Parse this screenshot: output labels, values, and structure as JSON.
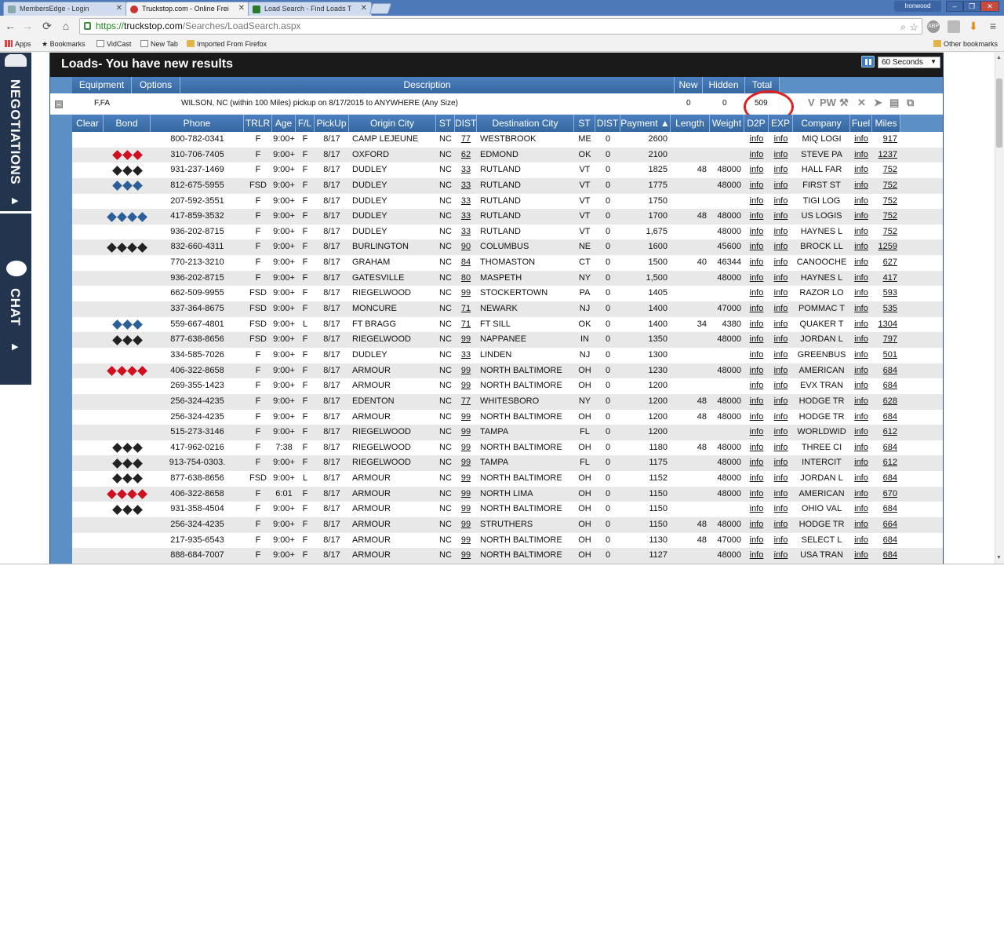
{
  "browser": {
    "tabs": [
      {
        "title": "MembersEdge - Login"
      },
      {
        "title": "Truckstop.com - Online Frei"
      },
      {
        "title": "Load Search - Find Loads T"
      }
    ],
    "profile_name": "Ironwood",
    "url": {
      "scheme": "https://",
      "host": "truckstop.com",
      "path": "/Searches/LoadSearch.aspx"
    },
    "ext_icon_label": "ABP",
    "bookmarks": [
      "Apps",
      "Bookmarks",
      "VidCast",
      "New Tab",
      "Imported From Firefox"
    ],
    "other_bookmarks": "Other bookmarks"
  },
  "sidebar": {
    "negotiations": "NEGOTIATIONS",
    "chat": "CHAT"
  },
  "panel": {
    "title": "Loads- You have new results",
    "refresh_option": "60 Seconds"
  },
  "summary": {
    "headers": {
      "equipment": "Equipment",
      "options": "Options",
      "description": "Description",
      "new": "New",
      "hidden": "Hidden",
      "total": "Total"
    },
    "equipment": "F,FA",
    "description": "WILSON, NC (within 100 Miles) pickup on 8/17/2015 to ANYWHERE (Any Size)",
    "new": "0",
    "hidden": "0",
    "total": "509",
    "action_icons": [
      "V",
      "PW"
    ]
  },
  "columns": [
    "Clear",
    "Bond",
    "Phone",
    "TRLR",
    "Age",
    "F/L",
    "PickUp",
    "Origin City",
    "ST",
    "DIST",
    "Destination City",
    "ST",
    "DIST",
    "Payment ▲",
    "Length",
    "Weight",
    "D2P",
    "EXP",
    "Company",
    "Fuel",
    "Miles"
  ],
  "rows": [
    {
      "bond": "",
      "bond_color": "",
      "phone": "800-782-0341",
      "trlr": "F",
      "age": "9:00+",
      "fl": "F",
      "pickup": "8/17",
      "origin": "CAMP LEJEUNE",
      "ost": "NC",
      "odist": "77",
      "dest": "WESTBROOK",
      "dst": "ME",
      "ddist": "0",
      "payment": "2600",
      "length": "",
      "weight": "",
      "d2p": "info",
      "exp": "info",
      "company": "MIQ LOGI",
      "fuel": "info",
      "miles": "917"
    },
    {
      "bond": 3,
      "bond_color": "red",
      "phone": "310-706-7405",
      "trlr": "F",
      "age": "9:00+",
      "fl": "F",
      "pickup": "8/17",
      "origin": "OXFORD",
      "ost": "NC",
      "odist": "62",
      "dest": "EDMOND",
      "dst": "OK",
      "ddist": "0",
      "payment": "2100",
      "length": "",
      "weight": "",
      "d2p": "info",
      "exp": "info",
      "company": "STEVE PA",
      "fuel": "info",
      "miles": "1237"
    },
    {
      "bond": 3,
      "bond_color": "black",
      "phone": "931-237-1469",
      "trlr": "F",
      "age": "9:00+",
      "fl": "F",
      "pickup": "8/17",
      "origin": "DUDLEY",
      "ost": "NC",
      "odist": "33",
      "dest": "RUTLAND",
      "dst": "VT",
      "ddist": "0",
      "payment": "1825",
      "length": "48",
      "weight": "48000",
      "d2p": "info",
      "exp": "info",
      "company": "HALL FAR",
      "fuel": "info",
      "miles": "752"
    },
    {
      "bond": 3,
      "bond_color": "blue",
      "phone": "812-675-5955",
      "trlr": "FSD",
      "age": "9:00+",
      "fl": "F",
      "pickup": "8/17",
      "origin": "DUDLEY",
      "ost": "NC",
      "odist": "33",
      "dest": "RUTLAND",
      "dst": "VT",
      "ddist": "0",
      "payment": "1775",
      "length": "",
      "weight": "48000",
      "d2p": "info",
      "exp": "info",
      "company": "FIRST ST",
      "fuel": "info",
      "miles": "752"
    },
    {
      "bond": "",
      "bond_color": "",
      "phone": "207-592-3551",
      "trlr": "F",
      "age": "9:00+",
      "fl": "F",
      "pickup": "8/17",
      "origin": "DUDLEY",
      "ost": "NC",
      "odist": "33",
      "dest": "RUTLAND",
      "dst": "VT",
      "ddist": "0",
      "payment": "1750",
      "length": "",
      "weight": "",
      "d2p": "info",
      "exp": "info",
      "company": "TIGI LOG",
      "fuel": "info",
      "miles": "752"
    },
    {
      "bond": 4,
      "bond_color": "blue",
      "phone": "417-859-3532",
      "trlr": "F",
      "age": "9:00+",
      "fl": "F",
      "pickup": "8/17",
      "origin": "DUDLEY",
      "ost": "NC",
      "odist": "33",
      "dest": "RUTLAND",
      "dst": "VT",
      "ddist": "0",
      "payment": "1700",
      "length": "48",
      "weight": "48000",
      "d2p": "info",
      "exp": "info",
      "company": "US LOGIS",
      "fuel": "info",
      "miles": "752"
    },
    {
      "bond": "",
      "bond_color": "",
      "phone": "936-202-8715",
      "trlr": "F",
      "age": "9:00+",
      "fl": "F",
      "pickup": "8/17",
      "origin": "DUDLEY",
      "ost": "NC",
      "odist": "33",
      "dest": "RUTLAND",
      "dst": "VT",
      "ddist": "0",
      "payment": "1,675",
      "length": "",
      "weight": "48000",
      "d2p": "info",
      "exp": "info",
      "company": "HAYNES L",
      "fuel": "info",
      "miles": "752"
    },
    {
      "bond": 4,
      "bond_color": "black",
      "phone": "832-660-4311",
      "trlr": "F",
      "age": "9:00+",
      "fl": "F",
      "pickup": "8/17",
      "origin": "BURLINGTON",
      "ost": "NC",
      "odist": "90",
      "dest": "COLUMBUS",
      "dst": "NE",
      "ddist": "0",
      "payment": "1600",
      "length": "",
      "weight": "45600",
      "d2p": "info",
      "exp": "info",
      "company": "BROCK LL",
      "fuel": "info",
      "miles": "1259"
    },
    {
      "bond": "",
      "bond_color": "",
      "phone": "770-213-3210",
      "trlr": "F",
      "age": "9:00+",
      "fl": "F",
      "pickup": "8/17",
      "origin": "GRAHAM",
      "ost": "NC",
      "odist": "84",
      "dest": "THOMASTON",
      "dst": "CT",
      "ddist": "0",
      "payment": "1500",
      "length": "40",
      "weight": "46344",
      "d2p": "info",
      "exp": "info",
      "company": "CANOOCHE",
      "fuel": "info",
      "miles": "627"
    },
    {
      "bond": "",
      "bond_color": "",
      "phone": "936-202-8715",
      "trlr": "F",
      "age": "9:00+",
      "fl": "F",
      "pickup": "8/17",
      "origin": "GATESVILLE",
      "ost": "NC",
      "odist": "80",
      "dest": "MASPETH",
      "dst": "NY",
      "ddist": "0",
      "payment": "1,500",
      "length": "",
      "weight": "48000",
      "d2p": "info",
      "exp": "info",
      "company": "HAYNES L",
      "fuel": "info",
      "miles": "417"
    },
    {
      "bond": "",
      "bond_color": "",
      "phone": "662-509-9955",
      "trlr": "FSD",
      "age": "9:00+",
      "fl": "F",
      "pickup": "8/17",
      "origin": "RIEGELWOOD",
      "ost": "NC",
      "odist": "99",
      "dest": "STOCKERTOWN",
      "dst": "PA",
      "ddist": "0",
      "payment": "1405",
      "length": "",
      "weight": "",
      "d2p": "info",
      "exp": "info",
      "company": "RAZOR LO",
      "fuel": "info",
      "miles": "593"
    },
    {
      "bond": "",
      "bond_color": "",
      "phone": "337-364-8675",
      "trlr": "FSD",
      "age": "9:00+",
      "fl": "F",
      "pickup": "8/17",
      "origin": "MONCURE",
      "ost": "NC",
      "odist": "71",
      "dest": "NEWARK",
      "dst": "NJ",
      "ddist": "0",
      "payment": "1400",
      "length": "",
      "weight": "47000",
      "d2p": "info",
      "exp": "info",
      "company": "POMMAC T",
      "fuel": "info",
      "miles": "535"
    },
    {
      "bond": 3,
      "bond_color": "blue",
      "phone": "559-667-4801",
      "trlr": "FSD",
      "age": "9:00+",
      "fl": "L",
      "pickup": "8/17",
      "origin": "FT BRAGG",
      "ost": "NC",
      "odist": "71",
      "dest": "FT SILL",
      "dst": "OK",
      "ddist": "0",
      "payment": "1400",
      "length": "34",
      "weight": "4380",
      "d2p": "info",
      "exp": "info",
      "company": "QUAKER T",
      "fuel": "info",
      "miles": "1304"
    },
    {
      "bond": 3,
      "bond_color": "black",
      "phone": "877-638-8656",
      "trlr": "FSD",
      "age": "9:00+",
      "fl": "F",
      "pickup": "8/17",
      "origin": "RIEGELWOOD",
      "ost": "NC",
      "odist": "99",
      "dest": "NAPPANEE",
      "dst": "IN",
      "ddist": "0",
      "payment": "1350",
      "length": "",
      "weight": "48000",
      "d2p": "info",
      "exp": "info",
      "company": "JORDAN L",
      "fuel": "info",
      "miles": "797"
    },
    {
      "bond": "",
      "bond_color": "",
      "phone": "334-585-7026",
      "trlr": "F",
      "age": "9:00+",
      "fl": "F",
      "pickup": "8/17",
      "origin": "DUDLEY",
      "ost": "NC",
      "odist": "33",
      "dest": "LINDEN",
      "dst": "NJ",
      "ddist": "0",
      "payment": "1300",
      "length": "",
      "weight": "",
      "d2p": "info",
      "exp": "info",
      "company": "GREENBUS",
      "fuel": "info",
      "miles": "501"
    },
    {
      "bond": 4,
      "bond_color": "red",
      "phone": "406-322-8658",
      "trlr": "F",
      "age": "9:00+",
      "fl": "F",
      "pickup": "8/17",
      "origin": "ARMOUR",
      "ost": "NC",
      "odist": "99",
      "dest": "NORTH BALTIMORE",
      "dst": "OH",
      "ddist": "0",
      "payment": "1230",
      "length": "",
      "weight": "48000",
      "d2p": "info",
      "exp": "info",
      "company": "AMERICAN",
      "fuel": "info",
      "miles": "684"
    },
    {
      "bond": "",
      "bond_color": "",
      "phone": "269-355-1423",
      "trlr": "F",
      "age": "9:00+",
      "fl": "F",
      "pickup": "8/17",
      "origin": "ARMOUR",
      "ost": "NC",
      "odist": "99",
      "dest": "NORTH BALTIMORE",
      "dst": "OH",
      "ddist": "0",
      "payment": "1200",
      "length": "",
      "weight": "",
      "d2p": "info",
      "exp": "info",
      "company": "EVX TRAN",
      "fuel": "info",
      "miles": "684"
    },
    {
      "bond": "",
      "bond_color": "",
      "phone": "256-324-4235",
      "trlr": "F",
      "age": "9:00+",
      "fl": "F",
      "pickup": "8/17",
      "origin": "EDENTON",
      "ost": "NC",
      "odist": "77",
      "dest": "WHITESBORO",
      "dst": "NY",
      "ddist": "0",
      "payment": "1200",
      "length": "48",
      "weight": "48000",
      "d2p": "info",
      "exp": "info",
      "company": "HODGE TR",
      "fuel": "info",
      "miles": "628"
    },
    {
      "bond": "",
      "bond_color": "",
      "phone": "256-324-4235",
      "trlr": "F",
      "age": "9:00+",
      "fl": "F",
      "pickup": "8/17",
      "origin": "ARMOUR",
      "ost": "NC",
      "odist": "99",
      "dest": "NORTH BALTIMORE",
      "dst": "OH",
      "ddist": "0",
      "payment": "1200",
      "length": "48",
      "weight": "48000",
      "d2p": "info",
      "exp": "info",
      "company": "HODGE TR",
      "fuel": "info",
      "miles": "684"
    },
    {
      "bond": "",
      "bond_color": "",
      "phone": "515-273-3146",
      "trlr": "F",
      "age": "9:00+",
      "fl": "F",
      "pickup": "8/17",
      "origin": "RIEGELWOOD",
      "ost": "NC",
      "odist": "99",
      "dest": "TAMPA",
      "dst": "FL",
      "ddist": "0",
      "payment": "1200",
      "length": "",
      "weight": "",
      "d2p": "info",
      "exp": "info",
      "company": "WORLDWID",
      "fuel": "info",
      "miles": "612"
    },
    {
      "bond": 3,
      "bond_color": "black",
      "phone": "417-962-0216",
      "trlr": "F",
      "age": "7:38",
      "fl": "F",
      "pickup": "8/17",
      "origin": "RIEGELWOOD",
      "ost": "NC",
      "odist": "99",
      "dest": "NORTH BALTIMORE",
      "dst": "OH",
      "ddist": "0",
      "payment": "1180",
      "length": "48",
      "weight": "48000",
      "d2p": "info",
      "exp": "info",
      "company": "THREE CI",
      "fuel": "info",
      "miles": "684"
    },
    {
      "bond": 3,
      "bond_color": "black",
      "phone": "913-754-0303.",
      "trlr": "F",
      "age": "9:00+",
      "fl": "F",
      "pickup": "8/17",
      "origin": "RIEGELWOOD",
      "ost": "NC",
      "odist": "99",
      "dest": "TAMPA",
      "dst": "FL",
      "ddist": "0",
      "payment": "1175",
      "length": "",
      "weight": "48000",
      "d2p": "info",
      "exp": "info",
      "company": "INTERCIT",
      "fuel": "info",
      "miles": "612"
    },
    {
      "bond": 3,
      "bond_color": "black",
      "phone": "877-638-8656",
      "trlr": "FSD",
      "age": "9:00+",
      "fl": "L",
      "pickup": "8/17",
      "origin": "ARMOUR",
      "ost": "NC",
      "odist": "99",
      "dest": "NORTH BALTIMORE",
      "dst": "OH",
      "ddist": "0",
      "payment": "1152",
      "length": "",
      "weight": "48000",
      "d2p": "info",
      "exp": "info",
      "company": "JORDAN L",
      "fuel": "info",
      "miles": "684"
    },
    {
      "bond": 4,
      "bond_color": "red",
      "phone": "406-322-8658",
      "trlr": "F",
      "age": "6:01",
      "fl": "F",
      "pickup": "8/17",
      "origin": "ARMOUR",
      "ost": "NC",
      "odist": "99",
      "dest": "NORTH LIMA",
      "dst": "OH",
      "ddist": "0",
      "payment": "1150",
      "length": "",
      "weight": "48000",
      "d2p": "info",
      "exp": "info",
      "company": "AMERICAN",
      "fuel": "info",
      "miles": "670"
    },
    {
      "bond": 3,
      "bond_color": "black",
      "phone": "931-358-4504",
      "trlr": "F",
      "age": "9:00+",
      "fl": "F",
      "pickup": "8/17",
      "origin": "ARMOUR",
      "ost": "NC",
      "odist": "99",
      "dest": "NORTH BALTIMORE",
      "dst": "OH",
      "ddist": "0",
      "payment": "1150",
      "length": "",
      "weight": "",
      "d2p": "info",
      "exp": "info",
      "company": "OHIO VAL",
      "fuel": "info",
      "miles": "684"
    },
    {
      "bond": "",
      "bond_color": "",
      "phone": "256-324-4235",
      "trlr": "F",
      "age": "9:00+",
      "fl": "F",
      "pickup": "8/17",
      "origin": "ARMOUR",
      "ost": "NC",
      "odist": "99",
      "dest": "STRUTHERS",
      "dst": "OH",
      "ddist": "0",
      "payment": "1150",
      "length": "48",
      "weight": "48000",
      "d2p": "info",
      "exp": "info",
      "company": "HODGE TR",
      "fuel": "info",
      "miles": "664"
    },
    {
      "bond": "",
      "bond_color": "",
      "phone": "217-935-6543",
      "trlr": "F",
      "age": "9:00+",
      "fl": "F",
      "pickup": "8/17",
      "origin": "ARMOUR",
      "ost": "NC",
      "odist": "99",
      "dest": "NORTH BALTIMORE",
      "dst": "OH",
      "ddist": "0",
      "payment": "1130",
      "length": "48",
      "weight": "47000",
      "d2p": "info",
      "exp": "info",
      "company": "SELECT L",
      "fuel": "info",
      "miles": "684"
    },
    {
      "bond": "",
      "bond_color": "",
      "phone": "888-684-7007",
      "trlr": "F",
      "age": "9:00+",
      "fl": "F",
      "pickup": "8/17",
      "origin": "ARMOUR",
      "ost": "NC",
      "odist": "99",
      "dest": "NORTH BALTIMORE",
      "dst": "OH",
      "ddist": "0",
      "payment": "1127",
      "length": "",
      "weight": "48000",
      "d2p": "info",
      "exp": "info",
      "company": "USA TRAN",
      "fuel": "info",
      "miles": "684"
    }
  ],
  "colors": {
    "header_blue": "#4a7fbf",
    "bond_red": "#d01020",
    "bond_black": "#222222",
    "bond_blue": "#2a5f9a",
    "highlight_circle": "#e02020"
  }
}
